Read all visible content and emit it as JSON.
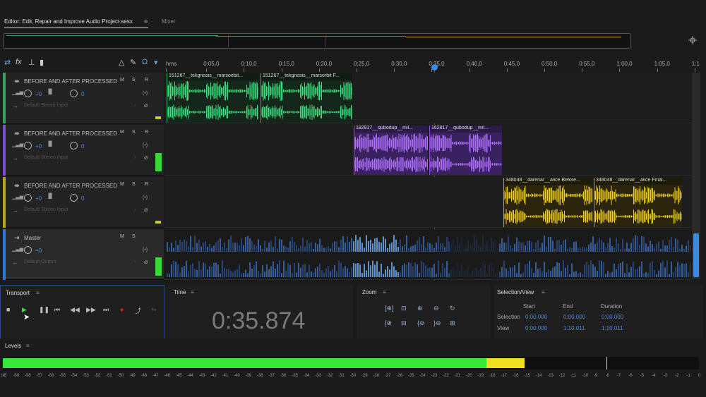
{
  "tabs": {
    "editor_label": "Editor: Edit, Repair and Improve Audio Project.sesx",
    "mixer_label": "Mixer",
    "menu_glyph": "≡"
  },
  "toolbar": {
    "icons": [
      "switch-icon",
      "fx-icon",
      "send-icon",
      "eq-icon"
    ],
    "right_icons": [
      "metronome-icon",
      "pencil-icon",
      "headphones-icon",
      "pin-icon"
    ]
  },
  "ruler": {
    "ticks": [
      "hms",
      "0:05,0",
      "0:10,0",
      "0:15,0",
      "0:20,0",
      "0:25,0",
      "0:30,0",
      "0:35,0",
      "0:40,0",
      "0:45,0",
      "0:50,0",
      "0:55,0",
      "1:00,0",
      "1:05,0",
      "1:1"
    ]
  },
  "tracks": [
    {
      "name": "BEFORE AND AFTER PROCESSED",
      "m": "M",
      "s": "S",
      "r": "R",
      "volume": "+0",
      "pan": "0",
      "input": "Default Stereo Input",
      "color": "#3aa060",
      "clips": [
        {
          "label": "151267__tekgnosis__marsoebit...",
          "color": "#2fb866",
          "wave": "#3ce07e"
        },
        {
          "label": "151267__tekgnosis__marsorbit F...",
          "color": "#2fb866",
          "wave": "#3ce07e"
        }
      ]
    },
    {
      "name": "BEFORE AND AFTER PROCESSED",
      "m": "M",
      "s": "S",
      "r": "R",
      "volume": "+0",
      "pan": "0",
      "input": "Default Stereo Input",
      "color": "#7a50c8",
      "clips": [
        {
          "label": "182817__qubodup__mil...",
          "color": "#8a4fd8",
          "wave": "#b070ff"
        },
        {
          "label": "162817__qubodup__mil...",
          "color": "#8a4fd8",
          "wave": "#b070ff"
        }
      ]
    },
    {
      "name": "BEFORE AND AFTER PROCESSED",
      "m": "M",
      "s": "S",
      "r": "R",
      "volume": "+0",
      "pan": "0",
      "input": "Default Stereo Input",
      "color": "#b8a020",
      "clips": [
        {
          "label": "348048__darenar__alice Before...",
          "color": "#c2a21a",
          "wave": "#f0d020"
        },
        {
          "label": "348048__darenar__alice Final...",
          "color": "#c2a21a",
          "wave": "#f0d020"
        }
      ]
    },
    {
      "name": "Master",
      "m": "M",
      "s": "S",
      "volume": "+0",
      "output": "Default Output",
      "color": "#2f7ad8"
    }
  ],
  "transport": {
    "title": "Transport",
    "menu": "≡",
    "buttons": [
      "stop-icon",
      "play-icon",
      "pause-icon",
      "go-start-icon",
      "rewind-icon",
      "fast-forward-icon",
      "go-end-icon",
      "record-icon",
      "loop-icon",
      "skip-icon"
    ]
  },
  "time": {
    "title": "Time",
    "menu": "≡",
    "value": "0:35.874"
  },
  "zoom": {
    "title": "Zoom",
    "menu": "≡"
  },
  "selection": {
    "title": "Selection/View",
    "menu": "≡",
    "headers": {
      "start": "Start",
      "end": "End",
      "duration": "Duration"
    },
    "rows": [
      {
        "label": "Selection",
        "start": "0:00.000",
        "end": "0:00.000",
        "duration": "0:00.000"
      },
      {
        "label": "View",
        "start": "0:00.000",
        "end": "1:10.011",
        "duration": "1:10.011"
      }
    ]
  },
  "levels": {
    "title": "Levels",
    "menu": "≡",
    "level_db": -15,
    "peak_db": -8,
    "scale": [
      "dB",
      "-59",
      "-58",
      "-57",
      "-56",
      "-55",
      "-54",
      "-53",
      "-52",
      "-51",
      "-50",
      "-49",
      "-48",
      "-47",
      "-46",
      "-45",
      "-44",
      "-43",
      "-42",
      "-41",
      "-40",
      "-39",
      "-38",
      "-37",
      "-36",
      "-35",
      "-34",
      "-33",
      "-32",
      "-31",
      "-30",
      "-29",
      "-28",
      "-27",
      "-26",
      "-25",
      "-24",
      "-23",
      "-22",
      "-21",
      "-20",
      "-19",
      "-18",
      "-17",
      "-16",
      "-15",
      "-14",
      "-13",
      "-12",
      "-11",
      "-10",
      "-9",
      "-8",
      "-7",
      "-6",
      "-5",
      "-4",
      "-3",
      "-2",
      "-1",
      "0"
    ]
  },
  "colors": {
    "accent": "#4a86e8",
    "green_meter": "#38e838",
    "yellow_meter": "#f0e020",
    "playhead": "#d02020"
  }
}
